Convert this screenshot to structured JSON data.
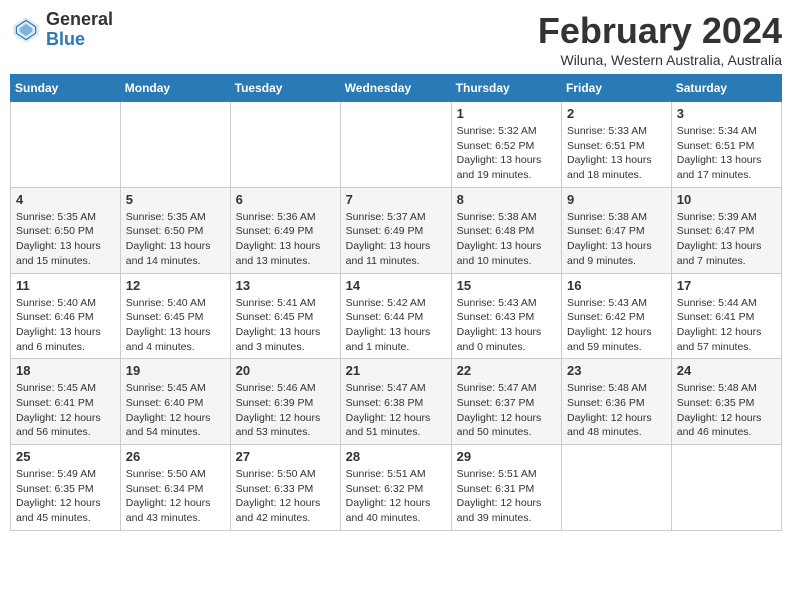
{
  "header": {
    "logo_general": "General",
    "logo_blue": "Blue",
    "month_title": "February 2024",
    "location": "Wiluna, Western Australia, Australia"
  },
  "days_of_week": [
    "Sunday",
    "Monday",
    "Tuesday",
    "Wednesday",
    "Thursday",
    "Friday",
    "Saturday"
  ],
  "weeks": [
    [
      {
        "day": "",
        "detail": ""
      },
      {
        "day": "",
        "detail": ""
      },
      {
        "day": "",
        "detail": ""
      },
      {
        "day": "",
        "detail": ""
      },
      {
        "day": "1",
        "detail": "Sunrise: 5:32 AM\nSunset: 6:52 PM\nDaylight: 13 hours\nand 19 minutes."
      },
      {
        "day": "2",
        "detail": "Sunrise: 5:33 AM\nSunset: 6:51 PM\nDaylight: 13 hours\nand 18 minutes."
      },
      {
        "day": "3",
        "detail": "Sunrise: 5:34 AM\nSunset: 6:51 PM\nDaylight: 13 hours\nand 17 minutes."
      }
    ],
    [
      {
        "day": "4",
        "detail": "Sunrise: 5:35 AM\nSunset: 6:50 PM\nDaylight: 13 hours\nand 15 minutes."
      },
      {
        "day": "5",
        "detail": "Sunrise: 5:35 AM\nSunset: 6:50 PM\nDaylight: 13 hours\nand 14 minutes."
      },
      {
        "day": "6",
        "detail": "Sunrise: 5:36 AM\nSunset: 6:49 PM\nDaylight: 13 hours\nand 13 minutes."
      },
      {
        "day": "7",
        "detail": "Sunrise: 5:37 AM\nSunset: 6:49 PM\nDaylight: 13 hours\nand 11 minutes."
      },
      {
        "day": "8",
        "detail": "Sunrise: 5:38 AM\nSunset: 6:48 PM\nDaylight: 13 hours\nand 10 minutes."
      },
      {
        "day": "9",
        "detail": "Sunrise: 5:38 AM\nSunset: 6:47 PM\nDaylight: 13 hours\nand 9 minutes."
      },
      {
        "day": "10",
        "detail": "Sunrise: 5:39 AM\nSunset: 6:47 PM\nDaylight: 13 hours\nand 7 minutes."
      }
    ],
    [
      {
        "day": "11",
        "detail": "Sunrise: 5:40 AM\nSunset: 6:46 PM\nDaylight: 13 hours\nand 6 minutes."
      },
      {
        "day": "12",
        "detail": "Sunrise: 5:40 AM\nSunset: 6:45 PM\nDaylight: 13 hours\nand 4 minutes."
      },
      {
        "day": "13",
        "detail": "Sunrise: 5:41 AM\nSunset: 6:45 PM\nDaylight: 13 hours\nand 3 minutes."
      },
      {
        "day": "14",
        "detail": "Sunrise: 5:42 AM\nSunset: 6:44 PM\nDaylight: 13 hours\nand 1 minute."
      },
      {
        "day": "15",
        "detail": "Sunrise: 5:43 AM\nSunset: 6:43 PM\nDaylight: 13 hours\nand 0 minutes."
      },
      {
        "day": "16",
        "detail": "Sunrise: 5:43 AM\nSunset: 6:42 PM\nDaylight: 12 hours\nand 59 minutes."
      },
      {
        "day": "17",
        "detail": "Sunrise: 5:44 AM\nSunset: 6:41 PM\nDaylight: 12 hours\nand 57 minutes."
      }
    ],
    [
      {
        "day": "18",
        "detail": "Sunrise: 5:45 AM\nSunset: 6:41 PM\nDaylight: 12 hours\nand 56 minutes."
      },
      {
        "day": "19",
        "detail": "Sunrise: 5:45 AM\nSunset: 6:40 PM\nDaylight: 12 hours\nand 54 minutes."
      },
      {
        "day": "20",
        "detail": "Sunrise: 5:46 AM\nSunset: 6:39 PM\nDaylight: 12 hours\nand 53 minutes."
      },
      {
        "day": "21",
        "detail": "Sunrise: 5:47 AM\nSunset: 6:38 PM\nDaylight: 12 hours\nand 51 minutes."
      },
      {
        "day": "22",
        "detail": "Sunrise: 5:47 AM\nSunset: 6:37 PM\nDaylight: 12 hours\nand 50 minutes."
      },
      {
        "day": "23",
        "detail": "Sunrise: 5:48 AM\nSunset: 6:36 PM\nDaylight: 12 hours\nand 48 minutes."
      },
      {
        "day": "24",
        "detail": "Sunrise: 5:48 AM\nSunset: 6:35 PM\nDaylight: 12 hours\nand 46 minutes."
      }
    ],
    [
      {
        "day": "25",
        "detail": "Sunrise: 5:49 AM\nSunset: 6:35 PM\nDaylight: 12 hours\nand 45 minutes."
      },
      {
        "day": "26",
        "detail": "Sunrise: 5:50 AM\nSunset: 6:34 PM\nDaylight: 12 hours\nand 43 minutes."
      },
      {
        "day": "27",
        "detail": "Sunrise: 5:50 AM\nSunset: 6:33 PM\nDaylight: 12 hours\nand 42 minutes."
      },
      {
        "day": "28",
        "detail": "Sunrise: 5:51 AM\nSunset: 6:32 PM\nDaylight: 12 hours\nand 40 minutes."
      },
      {
        "day": "29",
        "detail": "Sunrise: 5:51 AM\nSunset: 6:31 PM\nDaylight: 12 hours\nand 39 minutes."
      },
      {
        "day": "",
        "detail": ""
      },
      {
        "day": "",
        "detail": ""
      }
    ]
  ]
}
